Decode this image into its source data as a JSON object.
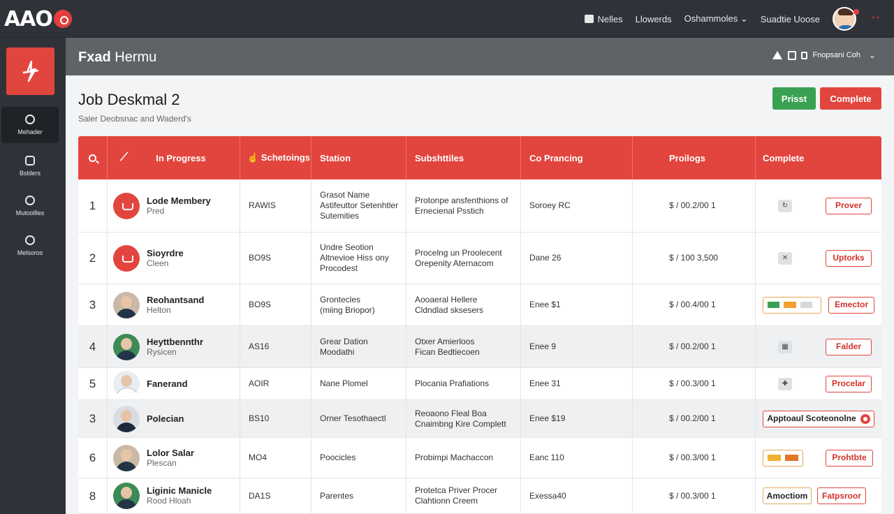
{
  "app": {
    "logo_text": "AAO",
    "brand_color": "#e2453e",
    "top_nav": [
      {
        "label": "Nelles",
        "icon": "inbox-icon"
      },
      {
        "label": "Llowerds"
      },
      {
        "label": "Oshammoles ⌄"
      },
      {
        "label": "Suadtie Uoose"
      }
    ]
  },
  "sidebar": {
    "items": [
      {
        "label": "Mehader",
        "icon": "home-icon"
      },
      {
        "label": "Bslders",
        "icon": "folder-icon"
      },
      {
        "label": "Mutoollles",
        "icon": "users-icon"
      },
      {
        "label": "Melsoros",
        "icon": "clock-icon"
      }
    ]
  },
  "subheader": {
    "title_bold": "Fxad",
    "title_rest": " Hermu",
    "right_label": "Fnopsani Coh"
  },
  "page": {
    "title": "Job Deskmal 2",
    "subtitle": "Saler Deobsnac and Waderd's",
    "btn_primary": "Prisst",
    "btn_complete": "Complete"
  },
  "table": {
    "columns": [
      "In Progress",
      "☝ Schetoings",
      "Station",
      "Subshttiles",
      "Co Prancing",
      "Proilogs",
      "Complete"
    ],
    "rows": [
      {
        "num": "1",
        "name": "Lode Membery",
        "sub": "Pred",
        "code": "RAWIS",
        "station": "Grasot Name\nAstifeuttor Setenhtler\nSutemities",
        "subs": "Protonpe ansfenthions of\nErnecienal Psstich",
        "pricing": "Soroey RC",
        "prologs": "$ / 00.2/00 1",
        "action": "Prover"
      },
      {
        "num": "2",
        "name": "Sioyrdre",
        "sub": "Cleen",
        "code": "BO9S",
        "station": "Undre Seotion\nAltnevioe Hiss ony\nProcodest",
        "subs": "Procelng un Proolecent\nOrepenity Aternacom",
        "pricing": "Dane 26",
        "prologs": "$ / 100 3,500",
        "action": "Uptorks"
      },
      {
        "num": "3",
        "name": "Reohantsand",
        "sub": "Helton",
        "code": "BO9S",
        "station": "Grontecles\n(miing Briopor)",
        "subs": "Aooaeral Hellere\nCldndlad sksesers",
        "pricing": "Enee $1",
        "prologs": "$ / 00.4/00 1",
        "action": "Emector"
      },
      {
        "num": "4",
        "name": "Heyttbennthr",
        "sub": "Rysicen",
        "code": "AS16",
        "station": "Grear Dation\nMoodathi",
        "subs": "Otxer Amierloos\nFican Bedtiecoen",
        "pricing": "Enee 9",
        "prologs": "$ / 00.2/00 1",
        "action": "Falder"
      },
      {
        "num": "5",
        "name": "Fanerand",
        "sub": "",
        "code": "AOIR",
        "station": "Nane Plomel",
        "subs": "Plocania Prafiations",
        "pricing": "Enee 31",
        "prologs": "$ / 00.3/00 1",
        "action": "Procelar"
      },
      {
        "num": "3",
        "name": "Polecian",
        "sub": "",
        "code": "BS10",
        "station": "Orner Tesothaectl",
        "subs": "Reoaono Fleal Boa\nCnaimbng Kire Complett",
        "pricing": "Enee $19",
        "prologs": "$ / 00.2/00 1",
        "action": "Apptoaul Scoteonolne"
      },
      {
        "num": "6",
        "name": "Lolor Salar",
        "sub": "Plescan",
        "code": "MO4",
        "station": "Poocicles",
        "subs": "Probimpi Machaccon",
        "pricing": "Eanc 110",
        "prologs": "$ / 00.3/00 1",
        "action": "Prohtbte"
      },
      {
        "num": "8",
        "name": "Liginic Manicle",
        "sub": "Rood Hloah",
        "code": "DA1S",
        "station": "Parentes",
        "subs": "Protetca Priver Procer\nClahtionn Creem",
        "pricing": "Exessa40",
        "prologs": "$ / 00.3/00 1",
        "action": "Fatpsroor",
        "extra": "Amoctiom"
      }
    ]
  }
}
